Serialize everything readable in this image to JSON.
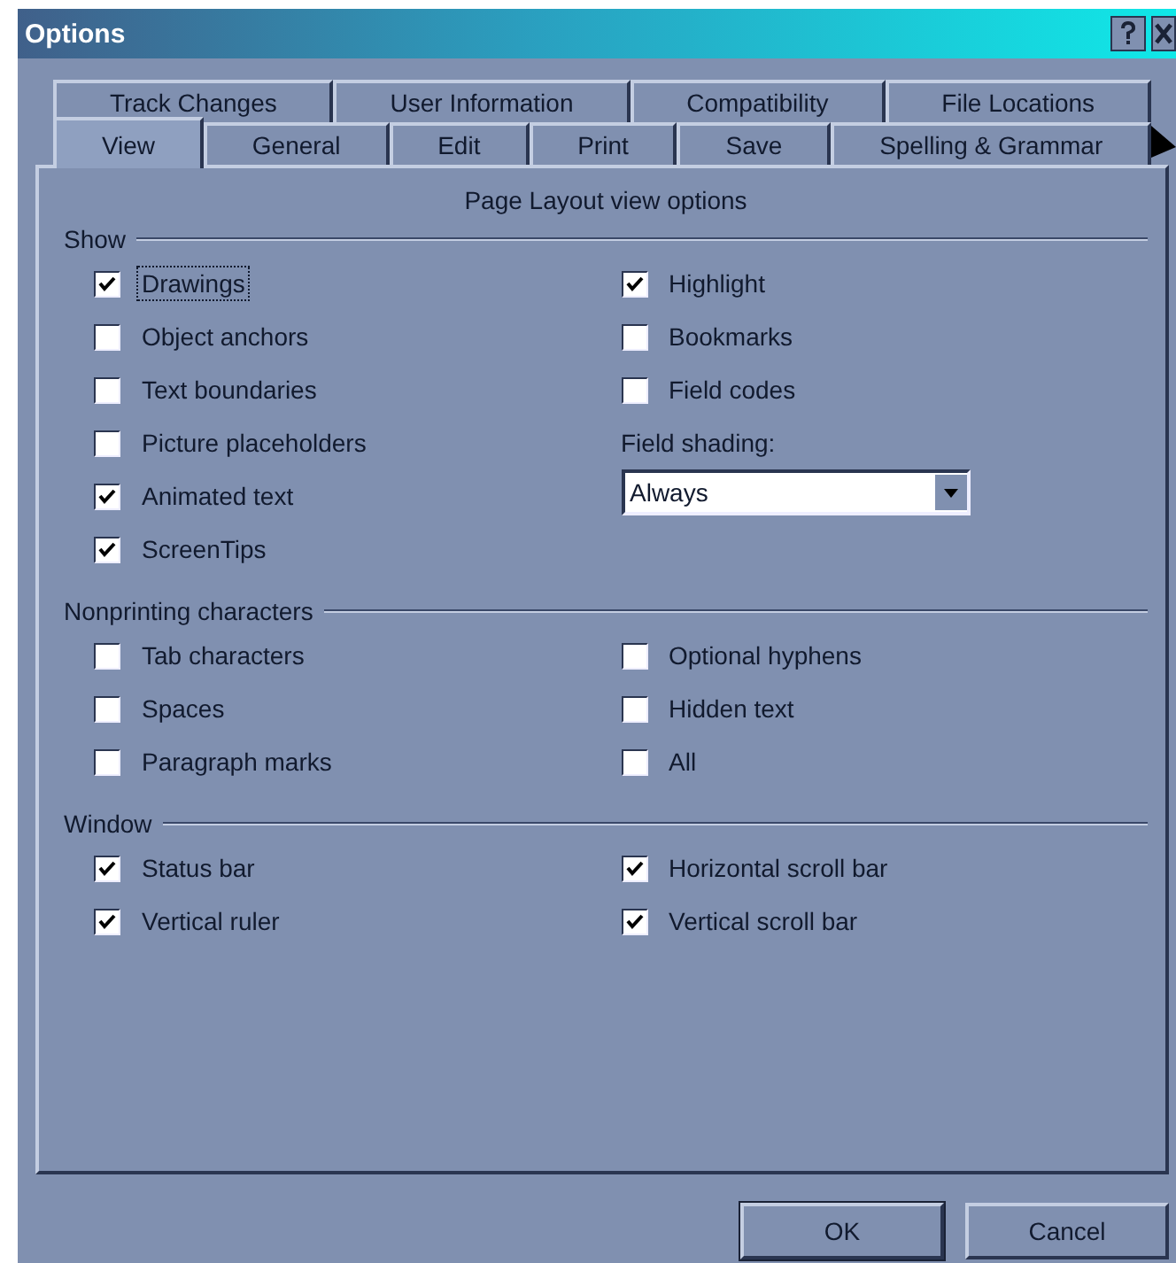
{
  "window": {
    "title": "Options"
  },
  "tab_rows": [
    {
      "tabs": [
        {
          "label": "Track Changes",
          "selected": false
        },
        {
          "label": "User Information",
          "selected": false
        },
        {
          "label": "Compatibility",
          "selected": false
        },
        {
          "label": "File Locations",
          "selected": false
        }
      ]
    },
    {
      "tabs": [
        {
          "label": "View",
          "selected": true
        },
        {
          "label": "General",
          "selected": false
        },
        {
          "label": "Edit",
          "selected": false
        },
        {
          "label": "Print",
          "selected": false
        },
        {
          "label": "Save",
          "selected": false
        },
        {
          "label": "Spelling & Grammar",
          "selected": false
        }
      ]
    }
  ],
  "heading": "Page Layout view options",
  "groups": [
    {
      "label": "Show",
      "left": [
        {
          "label": "Drawings",
          "checked": true,
          "focused": true
        },
        {
          "label": "Object anchors",
          "checked": false
        },
        {
          "label": "Text boundaries",
          "checked": false
        },
        {
          "label": "Picture placeholders",
          "checked": false
        },
        {
          "label": "Animated text",
          "checked": true
        },
        {
          "label": "ScreenTips",
          "checked": true
        }
      ],
      "right": [
        {
          "label": "Highlight",
          "checked": true
        },
        {
          "label": "Bookmarks",
          "checked": false
        },
        {
          "label": "Field codes",
          "checked": false
        }
      ],
      "field": {
        "label": "Field shading:",
        "value": "Always"
      }
    },
    {
      "label": "Nonprinting characters",
      "left": [
        {
          "label": "Tab characters",
          "checked": false
        },
        {
          "label": "Spaces",
          "checked": false
        },
        {
          "label": "Paragraph marks",
          "checked": false
        }
      ],
      "right": [
        {
          "label": "Optional hyphens",
          "checked": false
        },
        {
          "label": "Hidden text",
          "checked": false
        },
        {
          "label": "All",
          "checked": false
        }
      ]
    },
    {
      "label": "Window",
      "left": [
        {
          "label": "Status bar",
          "checked": true
        },
        {
          "label": "Vertical ruler",
          "checked": true
        }
      ],
      "right": [
        {
          "label": "Horizontal scroll bar",
          "checked": true
        },
        {
          "label": "Vertical scroll bar",
          "checked": true
        }
      ]
    }
  ],
  "buttons": [
    {
      "label": "OK",
      "default": true
    },
    {
      "label": "Cancel",
      "default": false
    }
  ]
}
